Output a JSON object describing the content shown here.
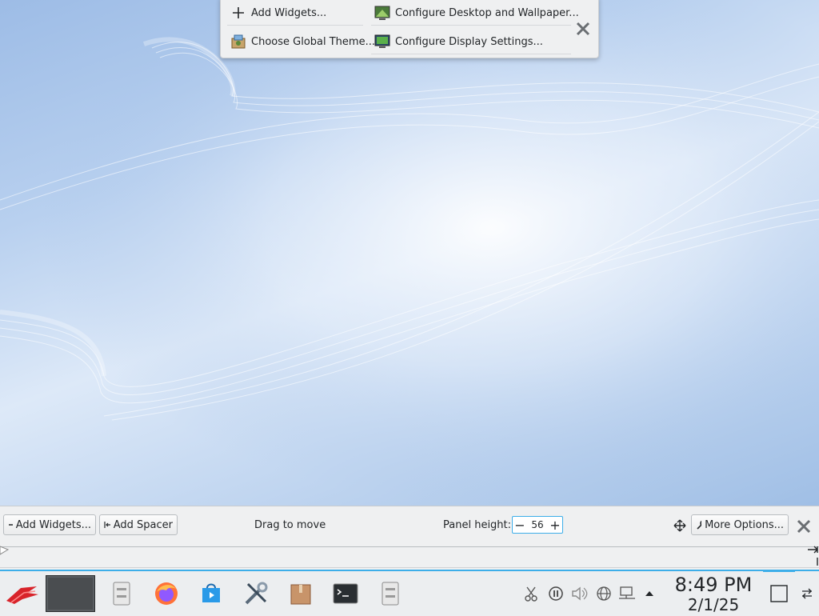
{
  "toolbox": {
    "add_widgets": "Add Widgets...",
    "choose_theme": "Choose Global Theme...",
    "configure_desktop": "Configure Desktop and Wallpaper...",
    "configure_display": "Configure Display Settings..."
  },
  "panel_config": {
    "add_widgets": "Add Widgets...",
    "add_spacer": "Add Spacer",
    "drag_to_move": "Drag to move",
    "panel_height_label": "Panel height:",
    "panel_height_value": "56",
    "more_options": "More Options..."
  },
  "taskbar": {
    "time": "8:49 PM",
    "date": "2/1/25",
    "icons": [
      "application-launcher-icon",
      "active-window-thumbnail",
      "file-manager-icon",
      "firefox-icon",
      "discover-store-icon",
      "system-settings-icon",
      "archive-icon",
      "terminal-icon",
      "file-manager-2-icon"
    ],
    "tray": [
      "scissors-icon",
      "media-pause-icon",
      "volume-icon",
      "network-globe-icon",
      "network-wired-icon",
      "tray-expand-icon"
    ]
  },
  "colors": {
    "accent": "#3daee9",
    "panel_bg": "#eff0f1"
  }
}
